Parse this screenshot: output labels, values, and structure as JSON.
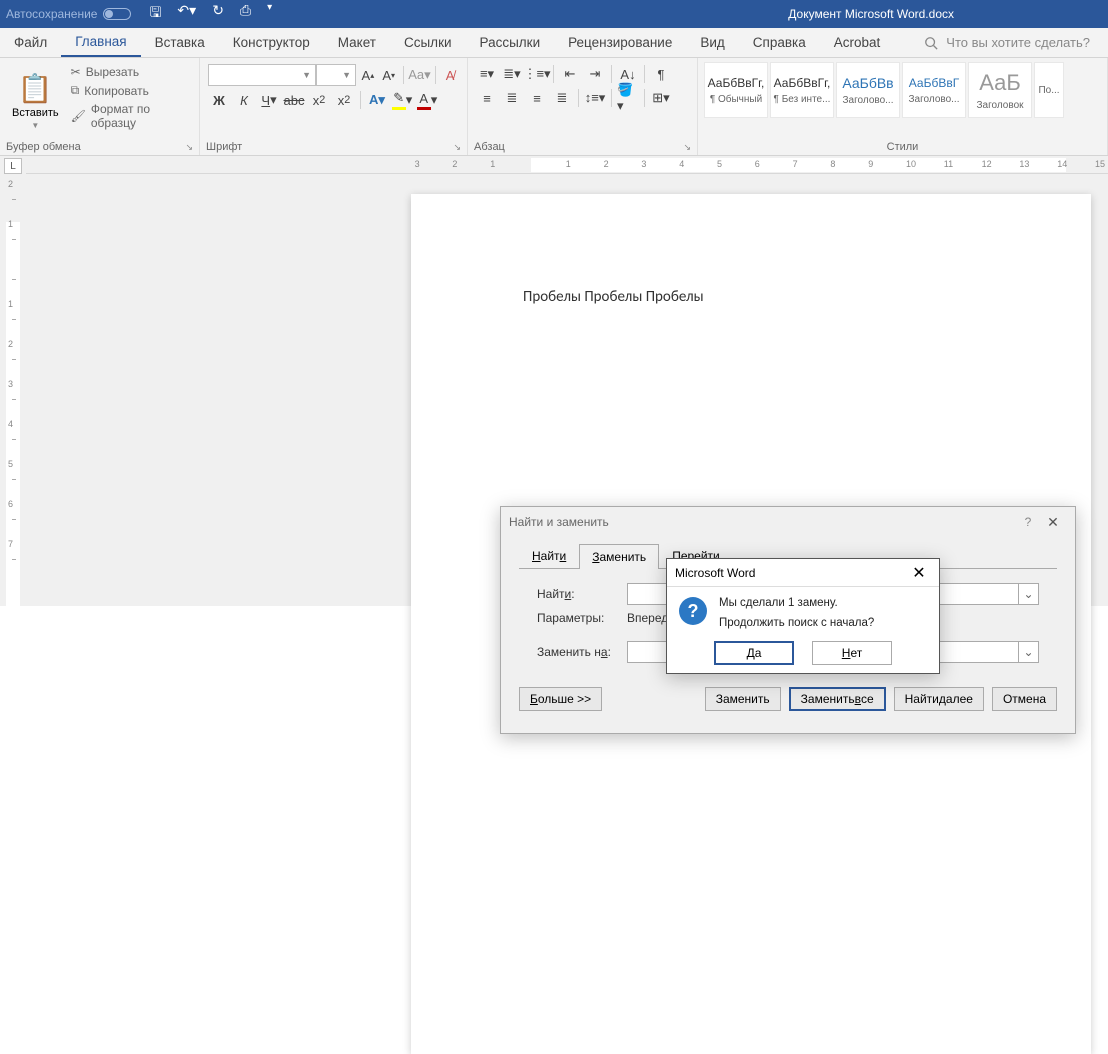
{
  "titlebar": {
    "autosave": "Автосохранение",
    "doc_title": "Документ Microsoft Word.docx"
  },
  "tabs": {
    "file": "Файл",
    "home": "Главная",
    "insert": "Вставка",
    "design": "Конструктор",
    "layout": "Макет",
    "references": "Ссылки",
    "mailings": "Рассылки",
    "review": "Рецензирование",
    "view": "Вид",
    "help": "Справка",
    "acrobat": "Acrobat",
    "tellme": "Что вы хотите сделать?"
  },
  "ribbon": {
    "clipboard": {
      "paste": "Вставить",
      "cut": "Вырезать",
      "copy": "Копировать",
      "formatpainter": "Формат по образцу",
      "label": "Буфер обмена"
    },
    "font": {
      "name": "",
      "size": "",
      "label": "Шрифт",
      "bold": "Ж",
      "italic": "К",
      "underline": "Ч",
      "strike": "abc",
      "sub": "x₂",
      "sup": "x²"
    },
    "paragraph": {
      "label": "Абзац"
    },
    "styles": {
      "label": "Стили",
      "items": [
        {
          "preview": "АаБбВвГг,",
          "name": "¶ Обычный",
          "color": "#333"
        },
        {
          "preview": "АаБбВвГг,",
          "name": "¶ Без инте...",
          "color": "#333"
        },
        {
          "preview": "АаБбВв",
          "name": "Заголово...",
          "color": "#2E74B5"
        },
        {
          "preview": "АаБбВвГ",
          "name": "Заголово...",
          "color": "#2E74B5"
        },
        {
          "preview": "АаБ",
          "name": "Заголовок",
          "color": "#999",
          "size": "22px"
        },
        {
          "preview": "",
          "name": "По...",
          "color": "#999"
        }
      ]
    }
  },
  "document": {
    "text": "Пробелы Пробелы Пробелы"
  },
  "ruler": {
    "h": [
      "3",
      "2",
      "1",
      "",
      "1",
      "2",
      "3",
      "4",
      "5",
      "6",
      "7",
      "8",
      "9",
      "10",
      "11",
      "12",
      "13",
      "14",
      "15"
    ],
    "v": [
      "2",
      "1",
      "",
      "1",
      "2",
      "3",
      "4",
      "5",
      "6",
      "7"
    ]
  },
  "dlg_fr": {
    "title": "Найти и заменить",
    "tab_find": "Найти",
    "tab_replace": "Заменить",
    "tab_goto": "Перейти",
    "find_label": "Найти:",
    "params_label": "Параметры:",
    "params_value": "Вперед",
    "replace_label": "Заменить на:",
    "more": "Больше >>",
    "replace_btn": "Заменить",
    "replace_all": "Заменить все",
    "find_next": "Найти далее",
    "cancel": "Отмена"
  },
  "dlg_msg": {
    "title": "Microsoft Word",
    "line1": "Мы сделали 1 замену.",
    "line2": "Продолжить поиск с начала?",
    "yes": "Да",
    "no": "Нет"
  }
}
